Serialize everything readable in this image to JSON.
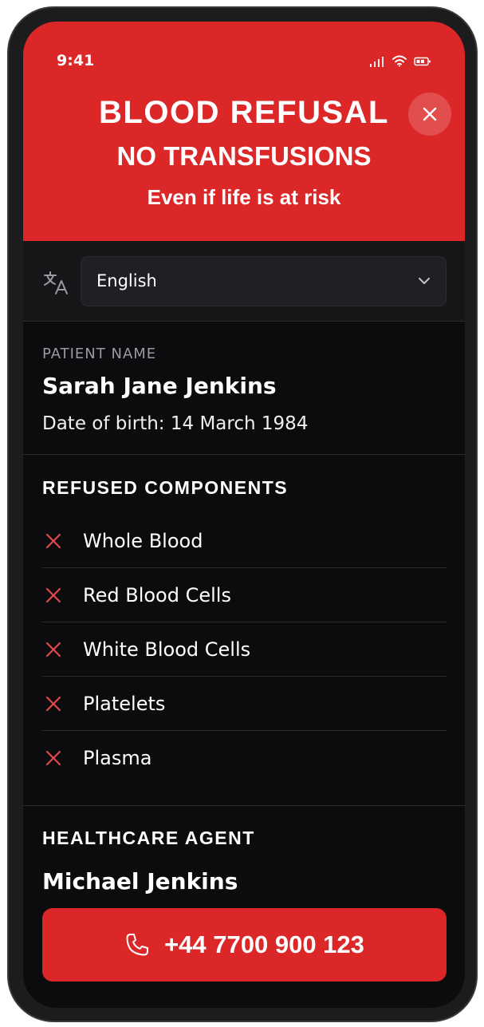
{
  "status_bar": {
    "time": "9:41",
    "icons": [
      "signal-icon",
      "wifi-icon",
      "battery-icon"
    ]
  },
  "header": {
    "title": "BLOOD REFUSAL",
    "subtitle": "NO TRANSFUSIONS",
    "warning": "Even if life is at risk",
    "close_icon": "close-icon",
    "background_color": "#dc2728"
  },
  "language": {
    "icon": "translate-icon",
    "selected": "English"
  },
  "patient": {
    "label": "PATIENT NAME",
    "name": "Sarah Jane Jenkins",
    "dob": "Date of birth: 14 March 1984"
  },
  "refused_components": {
    "title": "REFUSED COMPONENTS",
    "items": [
      {
        "label": "Whole Blood"
      },
      {
        "label": "Red Blood Cells"
      },
      {
        "label": "White Blood Cells"
      },
      {
        "label": "Platelets"
      },
      {
        "label": "Plasma"
      }
    ]
  },
  "healthcare_agent": {
    "title": "HEALTHCARE AGENT",
    "name": "Michael Jenkins",
    "phone": "+44 7700 900 123",
    "phone_icon": "phone-icon"
  },
  "colors": {
    "accent": "#dc2728",
    "background": "#0c0c0e",
    "x_icon": "#e0484b"
  }
}
